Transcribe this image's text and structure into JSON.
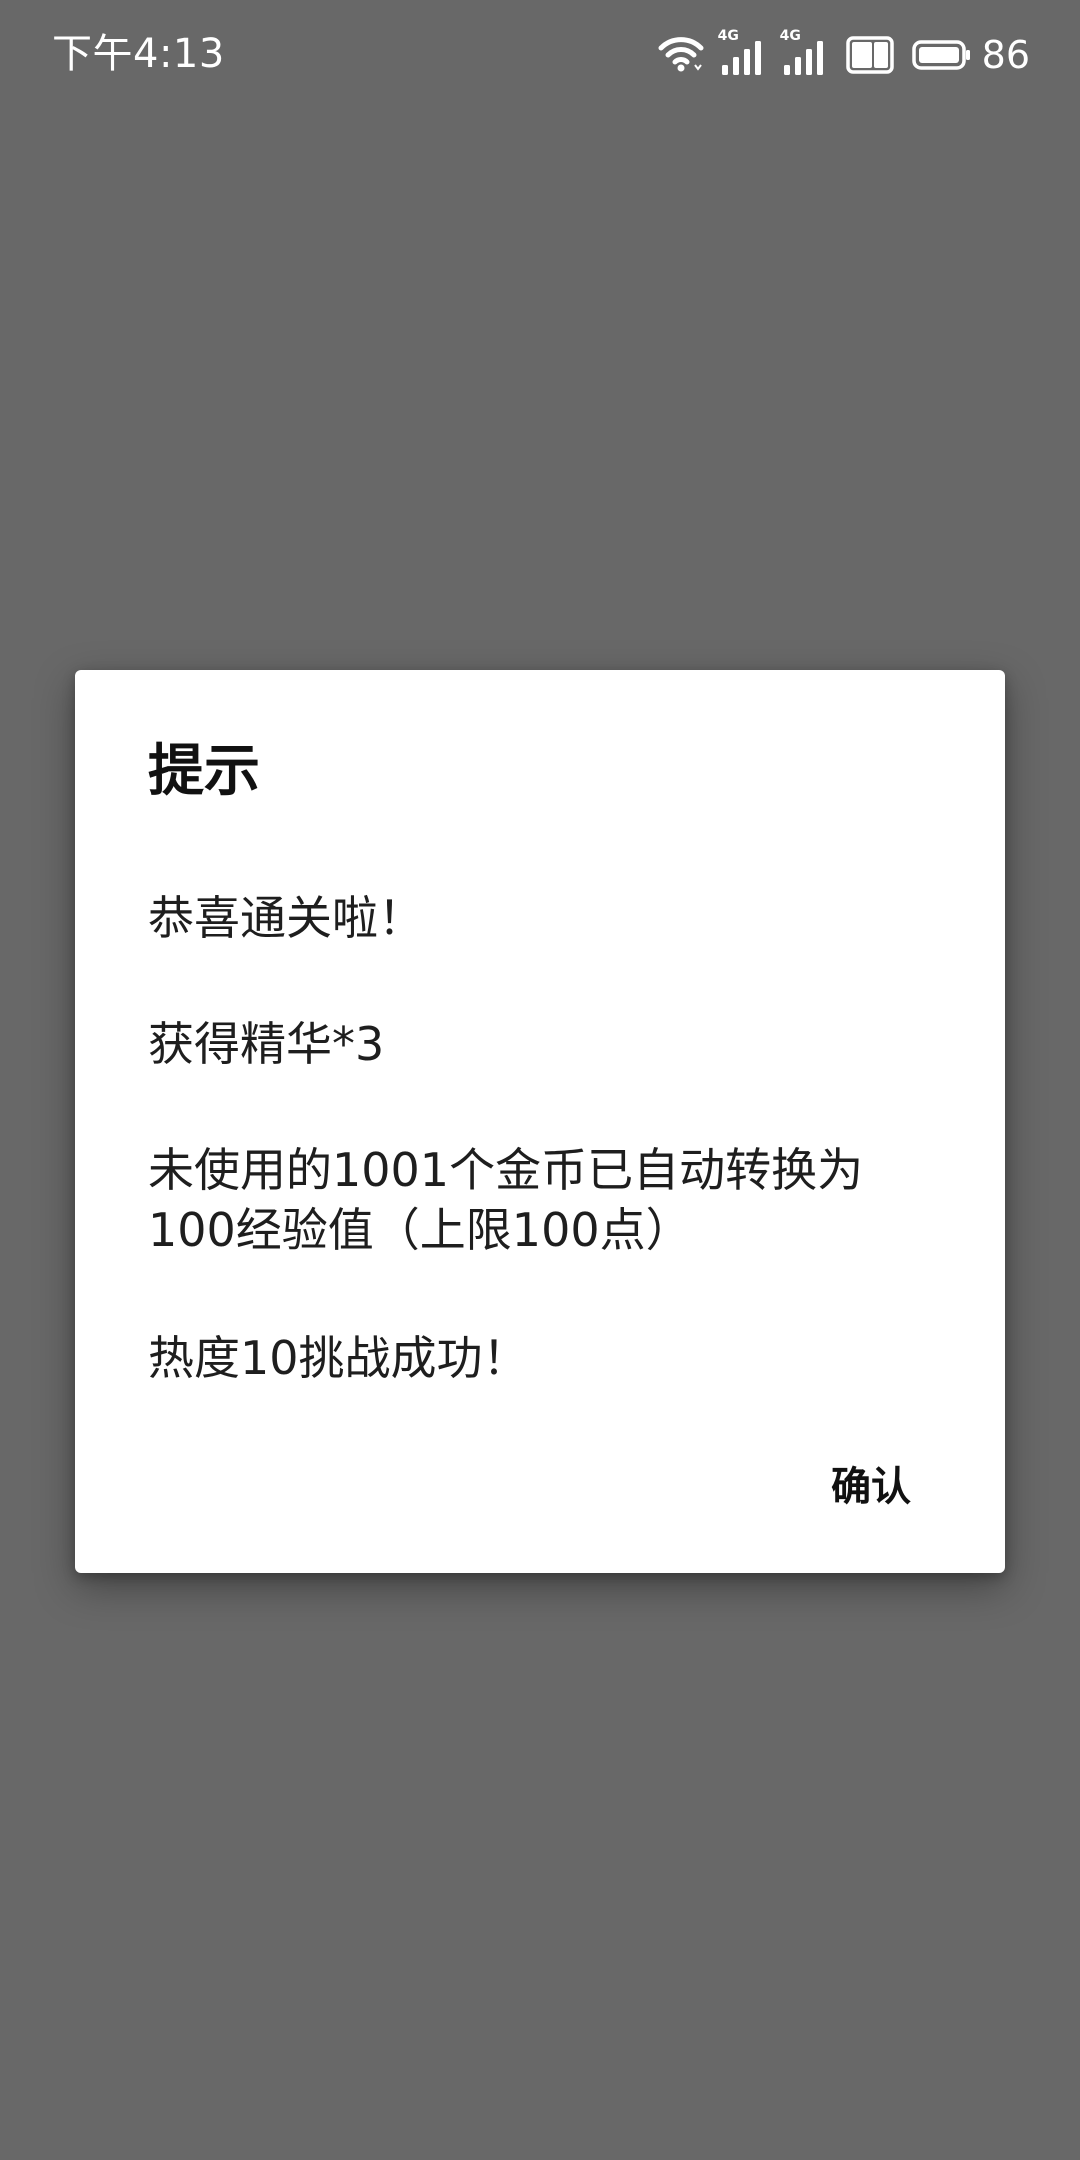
{
  "status_bar": {
    "time": "下午4:13",
    "network_1": "4G",
    "network_2": "4G",
    "battery_level": "86",
    "icons": [
      "wifi-icon",
      "signal-icon",
      "signal-icon",
      "hd-volte-icon",
      "battery-icon"
    ]
  },
  "dialog": {
    "title": "提示",
    "messages": [
      "恭喜通关啦！",
      "获得精华*3",
      "未使用的1001个金币已自动转换为100经验值（上限100点）",
      "热度10挑战成功！"
    ],
    "confirm_label": "确认"
  },
  "colors": {
    "overlay_background": "#686868",
    "dialog_background": "#ffffff",
    "text": "#1e1e1e"
  }
}
